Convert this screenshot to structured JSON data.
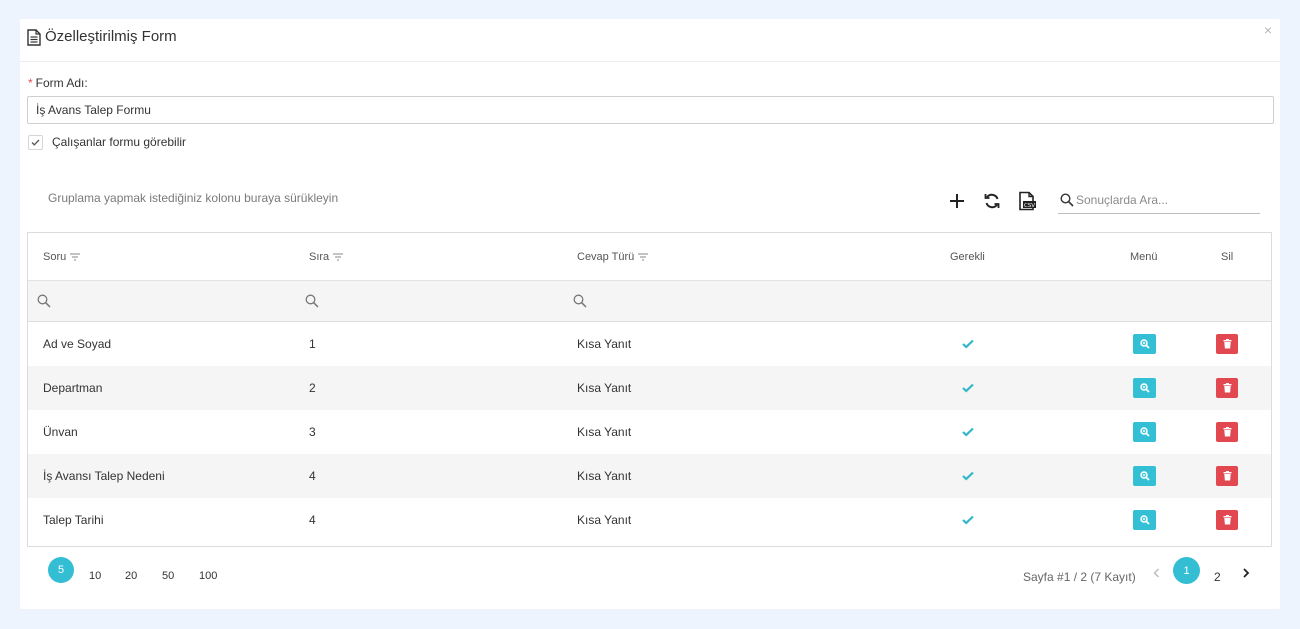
{
  "dialog": {
    "title": "Özelleştirilmiş Form",
    "close_label": "×"
  },
  "form": {
    "name_label": "Form Adı:",
    "required_mark": "*",
    "name_value": "İş Avans Talep Formu",
    "employees_see_label": "Çalışanlar formu görebilir",
    "employees_see_checked": true
  },
  "toolbar": {
    "group_hint": "Gruplama yapmak istediğiniz kolonu buraya sürükleyin",
    "search_placeholder": "Sonuçlarda Ara...",
    "icons": [
      "add-icon",
      "refresh-icon",
      "export-csv-icon",
      "search-icon"
    ]
  },
  "grid": {
    "columns": {
      "question": "Soru",
      "order": "Sıra",
      "answer_type": "Cevap Türü",
      "required": "Gerekli",
      "menu": "Menü",
      "delete": "Sil"
    },
    "rows": [
      {
        "question": "Ad ve Soyad",
        "order": "1",
        "answer_type": "Kısa Yanıt",
        "required": true
      },
      {
        "question": "Departman",
        "order": "2",
        "answer_type": "Kısa Yanıt",
        "required": true
      },
      {
        "question": "Ünvan",
        "order": "3",
        "answer_type": "Kısa Yanıt",
        "required": true
      },
      {
        "question": "İş Avansı Talep Nedeni",
        "order": "4",
        "answer_type": "Kısa Yanıt",
        "required": true
      },
      {
        "question": "Talep Tarihi",
        "order": "4",
        "answer_type": "Kısa Yanıt",
        "required": true
      }
    ]
  },
  "pager": {
    "page_sizes": [
      "5",
      "10",
      "20",
      "50",
      "100"
    ],
    "selected_page_size": "5",
    "info": "Sayfa #1 / 2 (7 Kayıt)",
    "pages": [
      "1",
      "2"
    ],
    "current_page": "1"
  },
  "colors": {
    "accent": "#34bed4",
    "danger": "#e2484f",
    "check": "#33b5c9",
    "background": "#eef4fd"
  }
}
